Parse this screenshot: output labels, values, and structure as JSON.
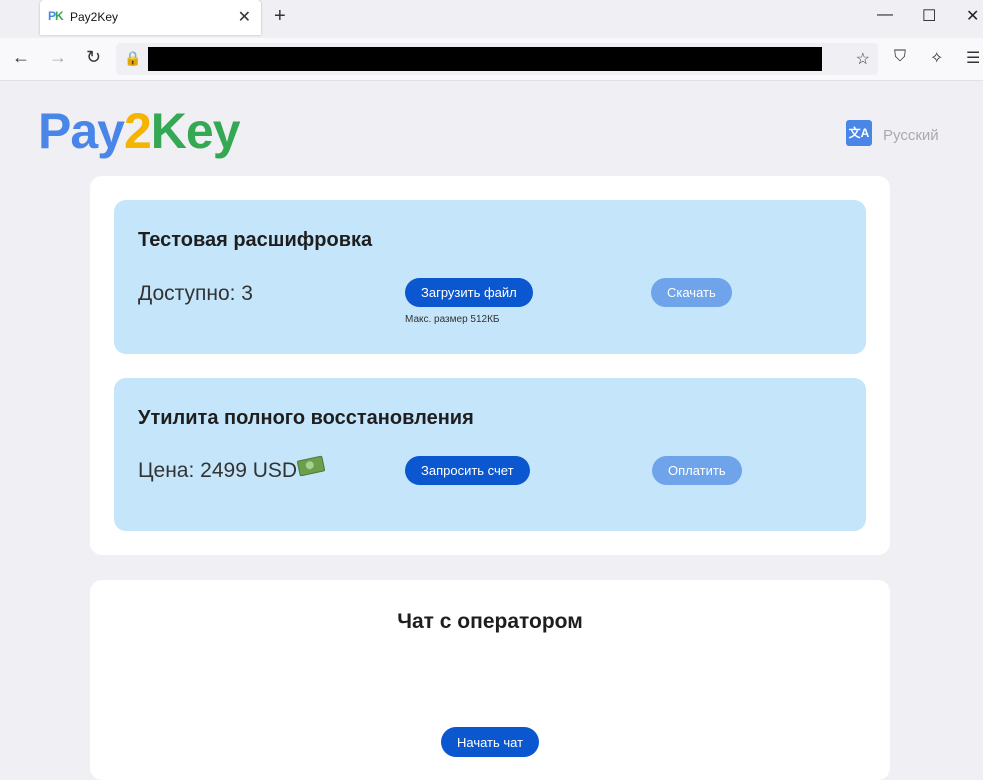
{
  "browser": {
    "tab_title": "Pay2Key",
    "tab_favicon": "PK",
    "close_glyph": "✕",
    "new_tab_glyph": "+",
    "minimize_glyph": "—",
    "maximize_glyph": "☐",
    "window_close_glyph": "✕",
    "back_glyph": "←",
    "forward_glyph": "→",
    "reload_glyph": "↻",
    "star_glyph": "☆",
    "shield_glyph": "⛉",
    "tool_glyph": "✧",
    "menu_glyph": "☰",
    "url": ""
  },
  "header": {
    "logo_part1": "Pay",
    "logo_part2": "2",
    "logo_part3": "Key",
    "language_icon_text": "文A",
    "language_label": "Русский"
  },
  "test_decryption": {
    "title": "Тестовая расшифровка",
    "available": "Доступно: 3",
    "upload_button": "Загрузить файл",
    "max_size": "Макс. размер 512КБ",
    "download_button": "Скачать"
  },
  "recovery_utility": {
    "title": "Утилита полного восстановления",
    "price": "Цена: 2499 USD",
    "request_invoice_button": "Запросить счет",
    "pay_button": "Оплатить"
  },
  "chat": {
    "title": "Чат с оператором",
    "start_button": "Начать чат"
  },
  "colors": {
    "logo_blue": "#4a86e8",
    "logo_yellow": "#f4b400",
    "logo_green": "#34a853",
    "panel_bg": "#c5e5fb",
    "button_primary": "#0b57d0",
    "button_disabled": "#6fa3ea"
  }
}
